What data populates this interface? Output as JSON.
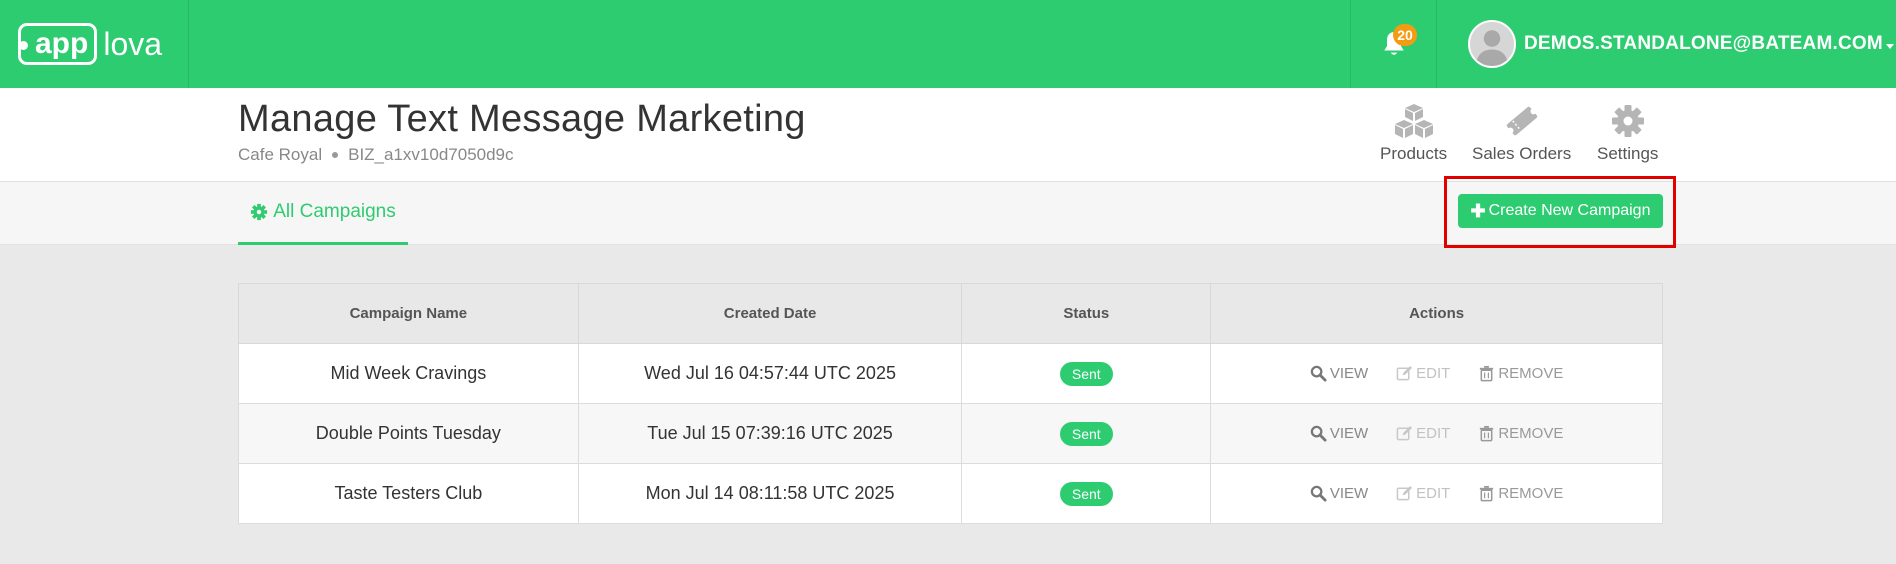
{
  "brand": {
    "app": "app",
    "lova": "lova"
  },
  "topbar": {
    "notification_count": "20",
    "user_email": "DEMOS.STANDALONE@BATEAM.COM"
  },
  "header": {
    "title": "Manage Text Message Marketing",
    "business_name": "Cafe Royal",
    "business_id": "BIZ_a1xv10d7050d9c",
    "nav": [
      {
        "label": "Products",
        "icon": "boxes-icon"
      },
      {
        "label": "Sales Orders",
        "icon": "ticket-icon"
      },
      {
        "label": "Settings",
        "icon": "gear-icon"
      }
    ]
  },
  "tabs": {
    "active_label": "All Campaigns"
  },
  "toolbar": {
    "create_label": "Create New Campaign"
  },
  "table": {
    "headers": [
      "Campaign Name",
      "Created Date",
      "Status",
      "Actions"
    ],
    "rows": [
      {
        "name": "Mid Week Cravings",
        "date": "Wed Jul 16 04:57:44 UTC 2025",
        "status": "Sent"
      },
      {
        "name": "Double Points Tuesday",
        "date": "Tue Jul 15 07:39:16 UTC 2025",
        "status": "Sent"
      },
      {
        "name": "Taste Testers Club",
        "date": "Mon Jul 14 08:11:58 UTC 2025",
        "status": "Sent"
      }
    ],
    "actions": {
      "view": "VIEW",
      "edit": "EDIT",
      "remove": "REMOVE"
    }
  },
  "colors": {
    "brand_green": "#2ecc71",
    "badge_orange": "#f39c12",
    "highlight_red": "#e00000"
  }
}
